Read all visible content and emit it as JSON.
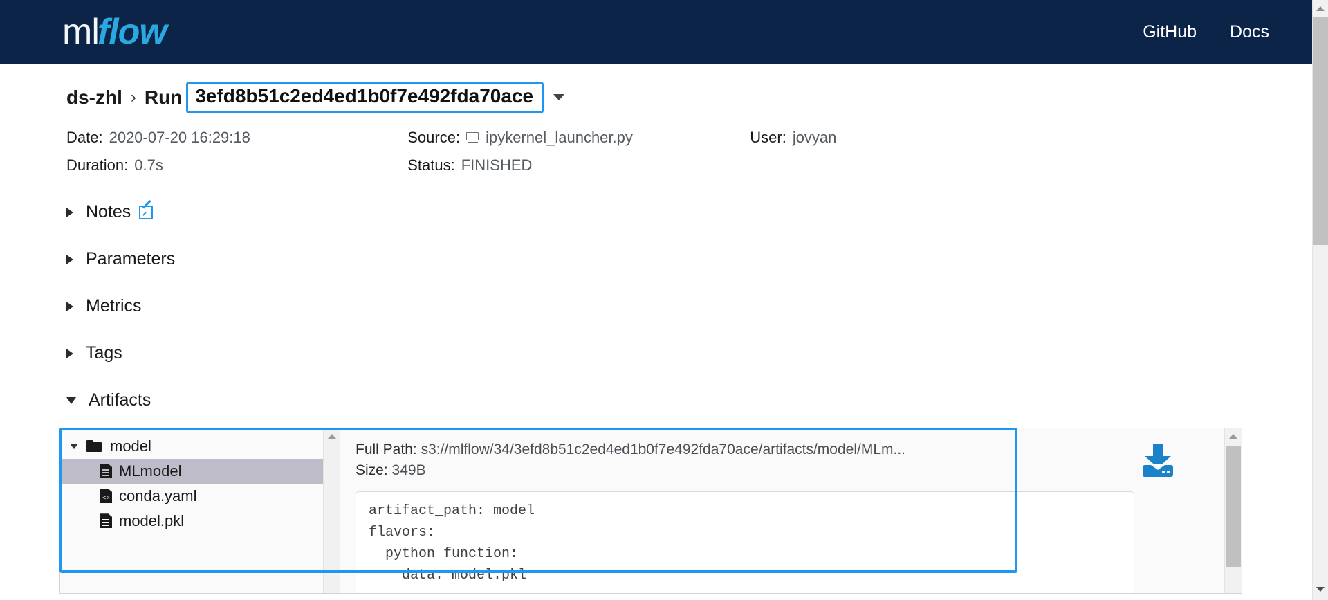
{
  "navbar": {
    "logo_ml": "ml",
    "logo_flow": "flow",
    "links": [
      {
        "label": "GitHub"
      },
      {
        "label": "Docs"
      }
    ]
  },
  "breadcrumb": {
    "experiment": "ds-zhl",
    "separator": "›",
    "run_label": "Run",
    "run_id": "3efd8b51c2ed4ed1b0f7e492fda70ace",
    "highlight_color": "#1f96ef"
  },
  "metadata": {
    "date_label": "Date:",
    "date_value": "2020-07-20 16:29:18",
    "source_label": "Source:",
    "source_value": "ipykernel_launcher.py",
    "source_icon": "monitor-icon",
    "user_label": "User:",
    "user_value": "jovyan",
    "duration_label": "Duration:",
    "duration_value": "0.7s",
    "status_label": "Status:",
    "status_value": "FINISHED"
  },
  "sections": [
    {
      "label": "Notes",
      "expanded": false,
      "has_edit_icon": true
    },
    {
      "label": "Parameters",
      "expanded": false,
      "has_edit_icon": false
    },
    {
      "label": "Metrics",
      "expanded": false,
      "has_edit_icon": false
    },
    {
      "label": "Tags",
      "expanded": false,
      "has_edit_icon": false
    },
    {
      "label": "Artifacts",
      "expanded": true,
      "has_edit_icon": false
    }
  ],
  "artifacts": {
    "tree": [
      {
        "name": "model",
        "type": "folder",
        "expanded": true,
        "selected": false
      },
      {
        "name": "MLmodel",
        "type": "file",
        "selected": true
      },
      {
        "name": "conda.yaml",
        "type": "code",
        "selected": false
      },
      {
        "name": "model.pkl",
        "type": "file",
        "selected": false
      }
    ],
    "full_path_label": "Full Path:",
    "full_path_value": "s3://mlflow/34/3efd8b51c2ed4ed1b0f7e492fda70ace/artifacts/model/MLm...",
    "size_label": "Size:",
    "size_value": "349B",
    "download_icon": "download-icon",
    "preview_lines": [
      "artifact_path: model",
      "flavors:",
      "  python_function:",
      "    data: model.pkl"
    ]
  }
}
